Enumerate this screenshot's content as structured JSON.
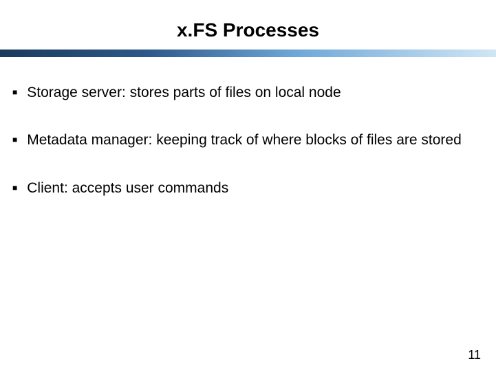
{
  "title": "x.FS Processes",
  "bullets": [
    {
      "text": "Storage server: stores parts of files on local node"
    },
    {
      "text": "Metadata manager: keeping track of where blocks of files are stored"
    },
    {
      "text": "Client: accepts user commands"
    }
  ],
  "page_number": "11"
}
